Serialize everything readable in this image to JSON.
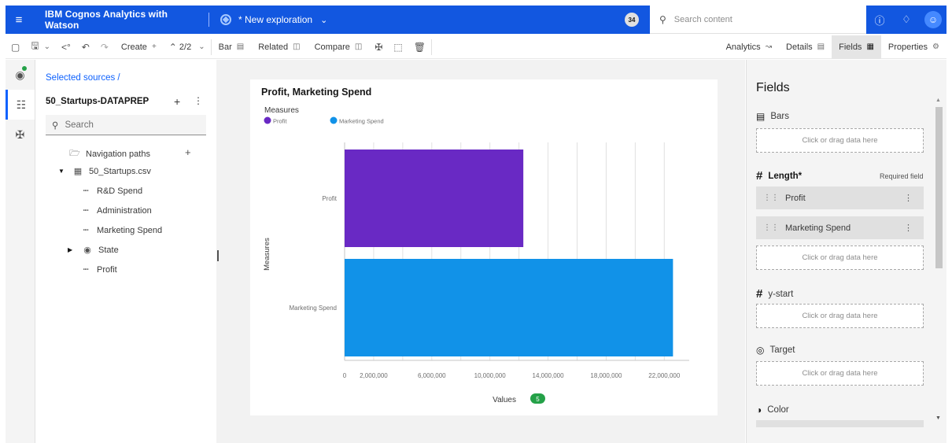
{
  "topbar": {
    "app_name": "IBM Cognos Analytics with Watson",
    "exploration_name": "* New exploration",
    "notification_count": "34",
    "search_placeholder": "Search content"
  },
  "toolbar": {
    "create_label": "Create",
    "page_indicator": "2/2",
    "bar_label": "Bar",
    "related_label": "Related",
    "compare_label": "Compare",
    "analytics_label": "Analytics",
    "details_label": "Details",
    "fields_label": "Fields",
    "properties_label": "Properties"
  },
  "sources": {
    "breadcrumb": "Selected sources  /",
    "source_name": "50_Startups-DATAPREP",
    "search_placeholder": "Search",
    "tree": {
      "navigation_paths": "Navigation paths",
      "file": "50_Startups.csv",
      "items": [
        "R&D Spend",
        "Administration",
        "Marketing Spend",
        "State",
        "Profit"
      ]
    }
  },
  "chart_data": {
    "type": "bar",
    "orientation": "horizontal",
    "title": "Profit, Marketing Spend",
    "legend_title": "Measures",
    "legend": [
      "Profit",
      "Marketing Spend"
    ],
    "categories": [
      "Profit",
      "Marketing Spend"
    ],
    "values": [
      12300000,
      22600000
    ],
    "colors": [
      "#6929c4",
      "#1192e8"
    ],
    "xlabel": "Values",
    "xlabel_badge": "5",
    "ylabel": "Measures",
    "xticks": [
      "0",
      "2,000,000",
      "6,000,000",
      "10,000,000",
      "14,000,000",
      "18,000,000",
      "22,000,000"
    ],
    "xlim": [
      0,
      23500000
    ],
    "grid": true
  },
  "fields_panel": {
    "title": "Fields",
    "bars_label": "Bars",
    "length_label": "Length*",
    "required_label": "Required field",
    "length_fields": [
      "Profit",
      "Marketing Spend"
    ],
    "ystart_label": "y-start",
    "target_label": "Target",
    "color_label": "Color",
    "dropzone_text": "Click or drag data here"
  }
}
